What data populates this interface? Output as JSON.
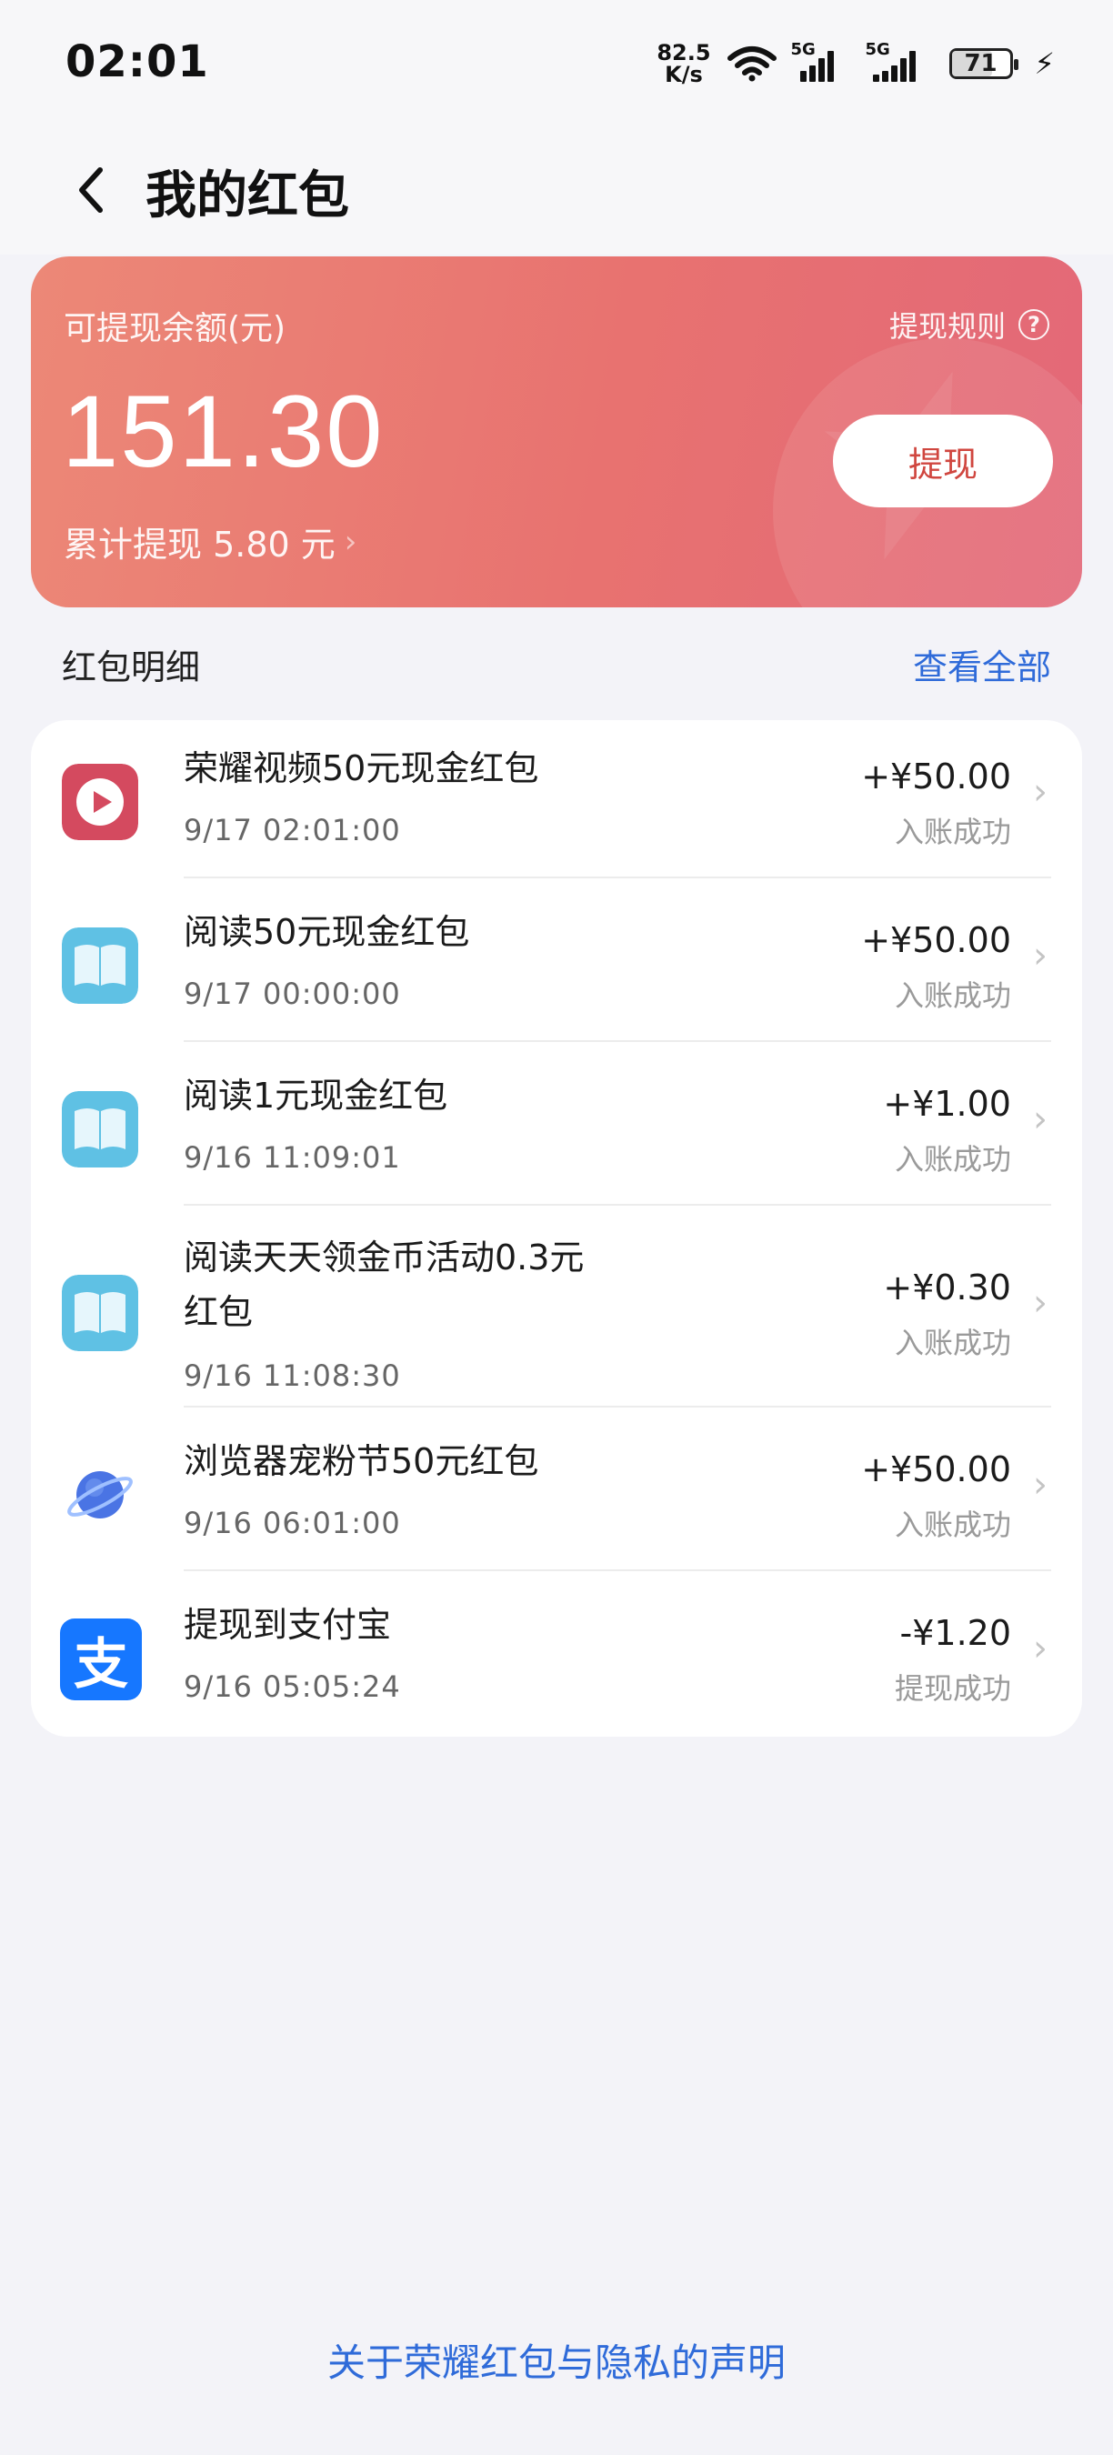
{
  "status_bar": {
    "time": "02:01",
    "net_speed_value": "82.5",
    "net_speed_unit": "K/s",
    "sim1_tag": "5G",
    "sim2_tag": "5G",
    "battery": "71"
  },
  "header": {
    "title": "我的红包"
  },
  "balance_card": {
    "label": "可提现余额(元)",
    "rules_label": "提现规则",
    "amount": "151.30",
    "total_withdrawn": "累计提现 5.80 元",
    "withdraw_button": "提现",
    "colors": {
      "gradient_start": "#ec8877",
      "gradient_end": "#e36878",
      "button_text": "#d0463f"
    }
  },
  "details": {
    "section_title": "红包明细",
    "see_all": "查看全部",
    "items": [
      {
        "icon": "play-icon",
        "name": "荣耀视频50元现金红包",
        "time": "9/17 02:01:00",
        "amount": "+¥50.00",
        "status": "入账成功"
      },
      {
        "icon": "book-icon",
        "name": "阅读50元现金红包",
        "time": "9/17 00:00:00",
        "amount": "+¥50.00",
        "status": "入账成功"
      },
      {
        "icon": "book-icon",
        "name": "阅读1元现金红包",
        "time": "9/16 11:09:01",
        "amount": "+¥1.00",
        "status": "入账成功"
      },
      {
        "icon": "book-icon",
        "name_line1": "阅读天天领金币活动0.3元",
        "name_line2": "红包",
        "time": "9/16 11:08:30",
        "amount": "+¥0.30",
        "status": "入账成功"
      },
      {
        "icon": "planet-icon",
        "name": "浏览器宠粉节50元红包",
        "time": "9/16 06:01:00",
        "amount": "+¥50.00",
        "status": "入账成功"
      },
      {
        "icon": "alipay-icon",
        "icon_text": "支",
        "name": "提现到支付宝",
        "time": "9/16 05:05:24",
        "amount": "-¥1.20",
        "status": "提现成功"
      }
    ]
  },
  "footer": {
    "privacy_link": "关于荣耀红包与隐私的声明"
  },
  "colors": {
    "link": "#2f6bd9",
    "background": "#f3f3f8"
  }
}
